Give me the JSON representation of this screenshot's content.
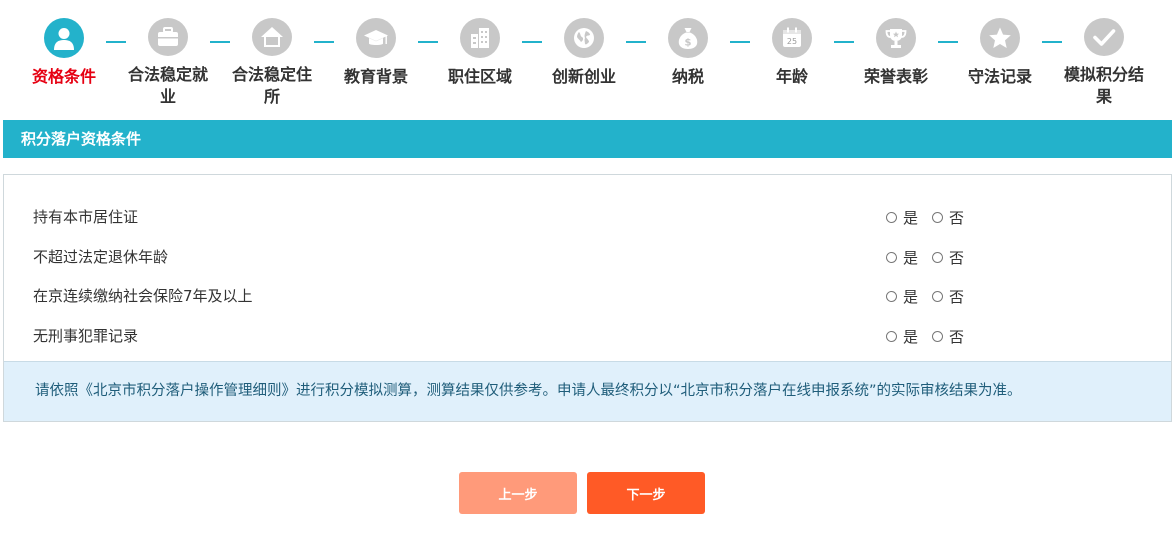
{
  "stepper": {
    "steps": [
      {
        "label": "资格条件",
        "icon": "person-icon",
        "active": true
      },
      {
        "label": "合法稳定就业",
        "icon": "briefcase-icon",
        "active": false
      },
      {
        "label": "合法稳定住所",
        "icon": "house-icon",
        "active": false
      },
      {
        "label": "教育背景",
        "icon": "graduation-cap-icon",
        "active": false
      },
      {
        "label": "职住区域",
        "icon": "buildings-icon",
        "active": false
      },
      {
        "label": "创新创业",
        "icon": "globe-icon",
        "active": false
      },
      {
        "label": "纳税",
        "icon": "money-bag-icon",
        "active": false
      },
      {
        "label": "年龄",
        "icon": "calendar-icon",
        "active": false
      },
      {
        "label": "荣誉表彰",
        "icon": "trophy-icon",
        "active": false
      },
      {
        "label": "守法记录",
        "icon": "star-icon",
        "active": false
      },
      {
        "label": "模拟积分结果",
        "icon": "checkmark-icon",
        "active": false
      }
    ],
    "calendar_day": "25",
    "money_symbol": "$"
  },
  "colors": {
    "accent": "#23b2cb",
    "active_label": "#e60012",
    "inactive_icon": "#c8c8c8",
    "notice_bg": "#e0f0fb",
    "prev_button": "#ff9a7a",
    "next_button": "#ff5a26"
  },
  "section": {
    "title": "积分落户资格条件"
  },
  "questions": [
    {
      "text": "持有本市居住证",
      "yes": "是",
      "no": "否"
    },
    {
      "text": "不超过法定退休年龄",
      "yes": "是",
      "no": "否"
    },
    {
      "text": "在京连续缴纳社会保险7年及以上",
      "yes": "是",
      "no": "否"
    },
    {
      "text": "无刑事犯罪记录",
      "yes": "是",
      "no": "否"
    }
  ],
  "notice": {
    "text": "请依照《北京市积分落户操作管理细则》进行积分模拟测算，测算结果仅供参考。申请人最终积分以“北京市积分落户在线申报系统”的实际审核结果为准。"
  },
  "buttons": {
    "prev_label": "上一步",
    "next_label": "下一步"
  }
}
